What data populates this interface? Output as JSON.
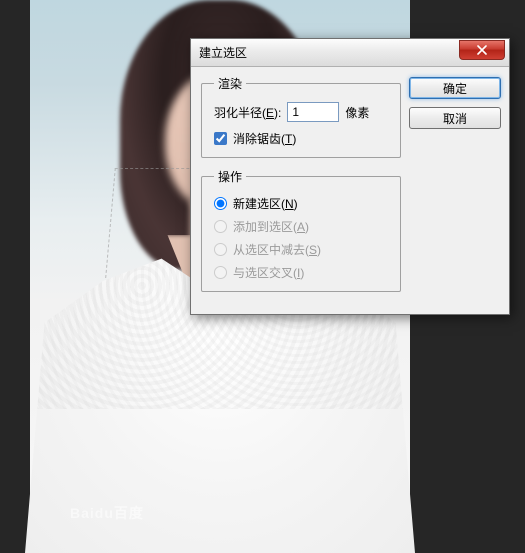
{
  "dialog": {
    "title": "建立选区",
    "ok_label": "确定",
    "cancel_label": "取消",
    "render_group": {
      "legend": "渲染",
      "feather_label_pre": "羽化半径(",
      "feather_hotkey": "E",
      "feather_label_post": "):",
      "feather_value": "1",
      "feather_unit": "像素",
      "antialias_label_pre": "消除锯齿(",
      "antialias_hotkey": "T",
      "antialias_label_post": ")",
      "antialias_checked": true
    },
    "operation_group": {
      "legend": "操作",
      "options": [
        {
          "label_pre": "新建选区(",
          "hotkey": "N",
          "label_post": ")",
          "checked": true,
          "enabled": true
        },
        {
          "label_pre": "添加到选区(",
          "hotkey": "A",
          "label_post": ")",
          "checked": false,
          "enabled": false
        },
        {
          "label_pre": "从选区中减去(",
          "hotkey": "S",
          "label_post": ")",
          "checked": false,
          "enabled": false
        },
        {
          "label_pre": "与选区交叉(",
          "hotkey": "I",
          "label_post": ")",
          "checked": false,
          "enabled": false
        }
      ]
    }
  },
  "watermark": "Baidu百度"
}
